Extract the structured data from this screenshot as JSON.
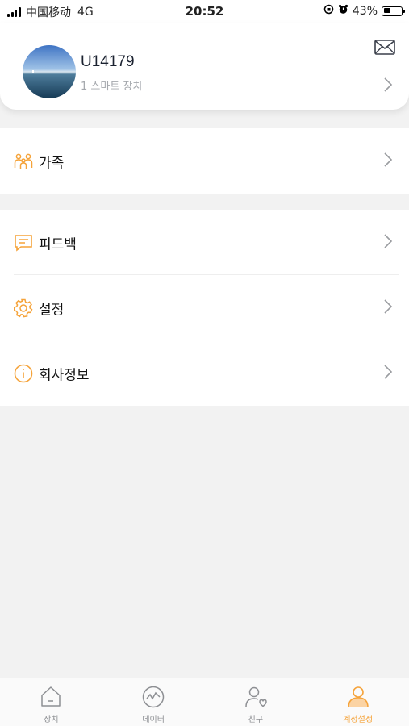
{
  "status_bar": {
    "carrier": "中国移动",
    "network": "4G",
    "time": "20:52",
    "battery": "43%",
    "battery_level": 0.43
  },
  "profile": {
    "user_id": "U14179",
    "device_count": "1 스마트 장치"
  },
  "menu": {
    "group1": [
      {
        "label": "가족",
        "icon": "family-icon"
      }
    ],
    "group2": [
      {
        "label": "피드백",
        "icon": "feedback-icon"
      },
      {
        "label": "설정",
        "icon": "gear-icon"
      },
      {
        "label": "회사정보",
        "icon": "info-icon"
      }
    ]
  },
  "tabs": [
    {
      "label": "장치",
      "icon": "home-icon",
      "active": false
    },
    {
      "label": "데이터",
      "icon": "chart-icon",
      "active": false
    },
    {
      "label": "친구",
      "icon": "friend-icon",
      "active": false
    },
    {
      "label": "계정설정",
      "icon": "account-icon",
      "active": true
    }
  ],
  "colors": {
    "accent": "#f5a33a",
    "background": "#f2f2f2",
    "inactive_tab": "#8d8f93"
  }
}
